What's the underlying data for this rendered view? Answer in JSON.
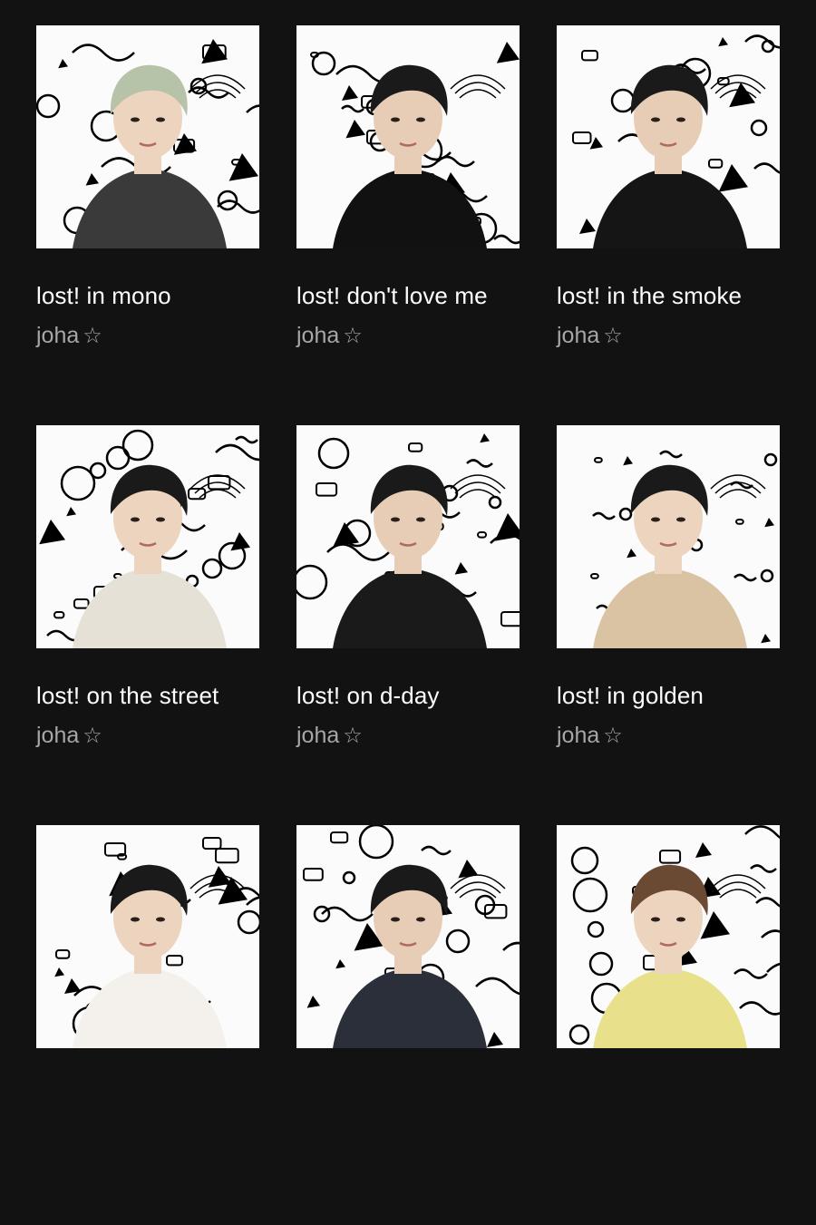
{
  "playlists": [
    {
      "title": "lost! in mono",
      "owner": "joha",
      "badge": "☆",
      "tone": "#3a3a3a",
      "bg": "#2b3a44",
      "cover_icon": "portrait-photo-icon"
    },
    {
      "title": "lost! don't love me",
      "owner": "joha",
      "badge": "☆",
      "tone": "#111111",
      "bg": "#1a1a1a",
      "cover_icon": "portrait-photo-icon"
    },
    {
      "title": "lost! in the smoke",
      "owner": "joha",
      "badge": "☆",
      "tone": "#151515",
      "bg": "#1c1c1c",
      "cover_icon": "portrait-photo-icon"
    },
    {
      "title": "lost! on the street",
      "owner": "joha",
      "badge": "☆",
      "tone": "#e6e1d6",
      "bg": "#2a3040",
      "cover_icon": "portrait-photo-icon"
    },
    {
      "title": "lost! on d-day",
      "owner": "joha",
      "badge": "☆",
      "tone": "#1a1a1a",
      "bg": "#222222",
      "cover_icon": "portrait-photo-icon"
    },
    {
      "title": "lost! in golden",
      "owner": "joha",
      "badge": "☆",
      "tone": "#d9c3a3",
      "bg": "#e8d5b8",
      "cover_icon": "portrait-photo-icon"
    },
    {
      "title": "",
      "owner": "",
      "badge": "",
      "tone": "#f4f1ec",
      "bg": "#e9e6e0",
      "cover_icon": "portrait-photo-icon"
    },
    {
      "title": "",
      "owner": "",
      "badge": "",
      "tone": "#2a2f3a",
      "bg": "#1e2230",
      "cover_icon": "portrait-photo-icon"
    },
    {
      "title": "",
      "owner": "",
      "badge": "",
      "tone": "#e8e08a",
      "bg": "#ece6a0",
      "cover_icon": "portrait-photo-icon"
    }
  ],
  "colors": {
    "background": "#121212",
    "title": "#ffffff",
    "owner": "#a7a7a7"
  }
}
